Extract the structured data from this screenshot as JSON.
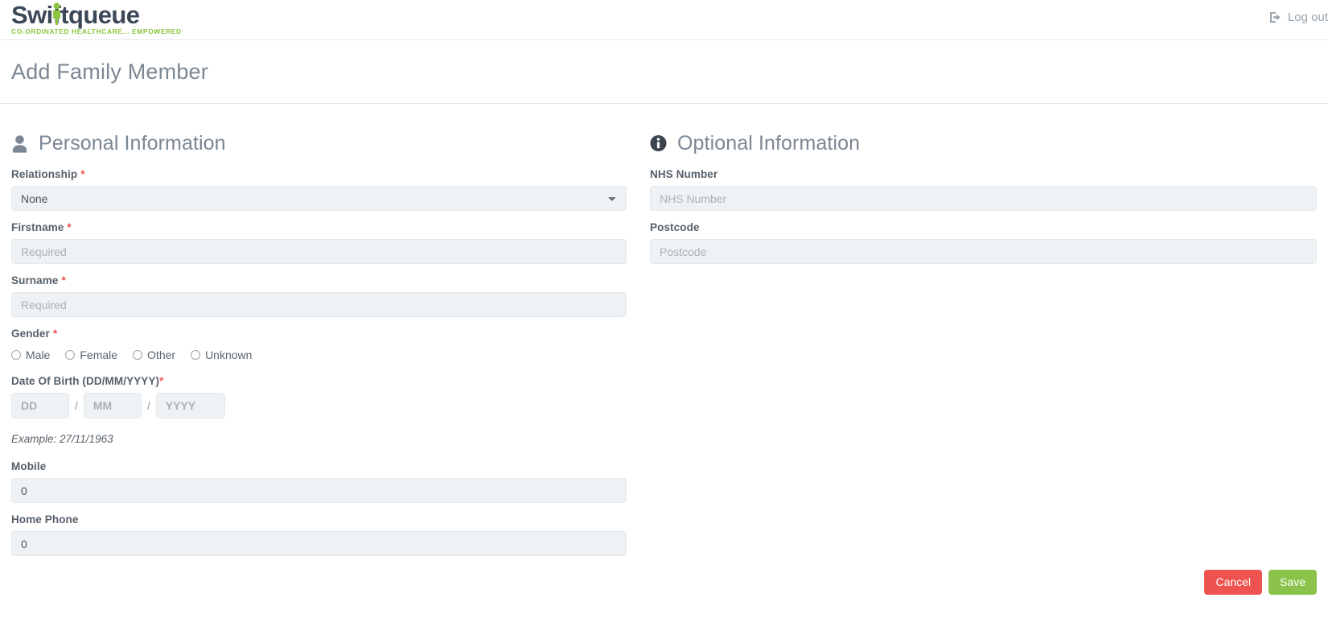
{
  "brand": {
    "name": "Swiftqueue",
    "tagline": "CO-ORDINATED HEALTHCARE... EMPOWERED",
    "green": "#8cc63f",
    "navy": "#3c4858"
  },
  "topbar": {
    "logout_label": "Log out",
    "logout_icon": "sign-out-icon"
  },
  "page": {
    "title": "Add Family Member"
  },
  "personal": {
    "icon": "user-icon",
    "heading": "Personal Information",
    "relationship": {
      "label": "Relationship",
      "required": "*",
      "value": "None",
      "options": [
        "None"
      ]
    },
    "firstname": {
      "label": "Firstname",
      "required": "*",
      "placeholder": "Required",
      "value": ""
    },
    "surname": {
      "label": "Surname",
      "required": "*",
      "placeholder": "Required",
      "value": ""
    },
    "gender": {
      "label": "Gender",
      "required": "*",
      "options": [
        "Male",
        "Female",
        "Other",
        "Unknown"
      ],
      "selected": ""
    },
    "dob": {
      "label": "Date Of Birth (DD/MM/YYYY)",
      "required": "*",
      "day_placeholder": "DD",
      "month_placeholder": "MM",
      "year_placeholder": "YYYY",
      "separator": "/",
      "example": "Example: 27/11/1963"
    },
    "mobile": {
      "label": "Mobile",
      "value": "0"
    },
    "home_phone": {
      "label": "Home Phone",
      "value": "0"
    }
  },
  "optional": {
    "icon": "info-icon",
    "heading": "Optional Information",
    "nhs_number": {
      "label": "NHS Number",
      "placeholder": "NHS Number",
      "value": ""
    },
    "postcode": {
      "label": "Postcode",
      "placeholder": "Postcode",
      "value": ""
    }
  },
  "actions": {
    "cancel_label": "Cancel",
    "cancel_color": "#ef5350",
    "save_label": "Save",
    "save_color": "#8bc34a"
  }
}
